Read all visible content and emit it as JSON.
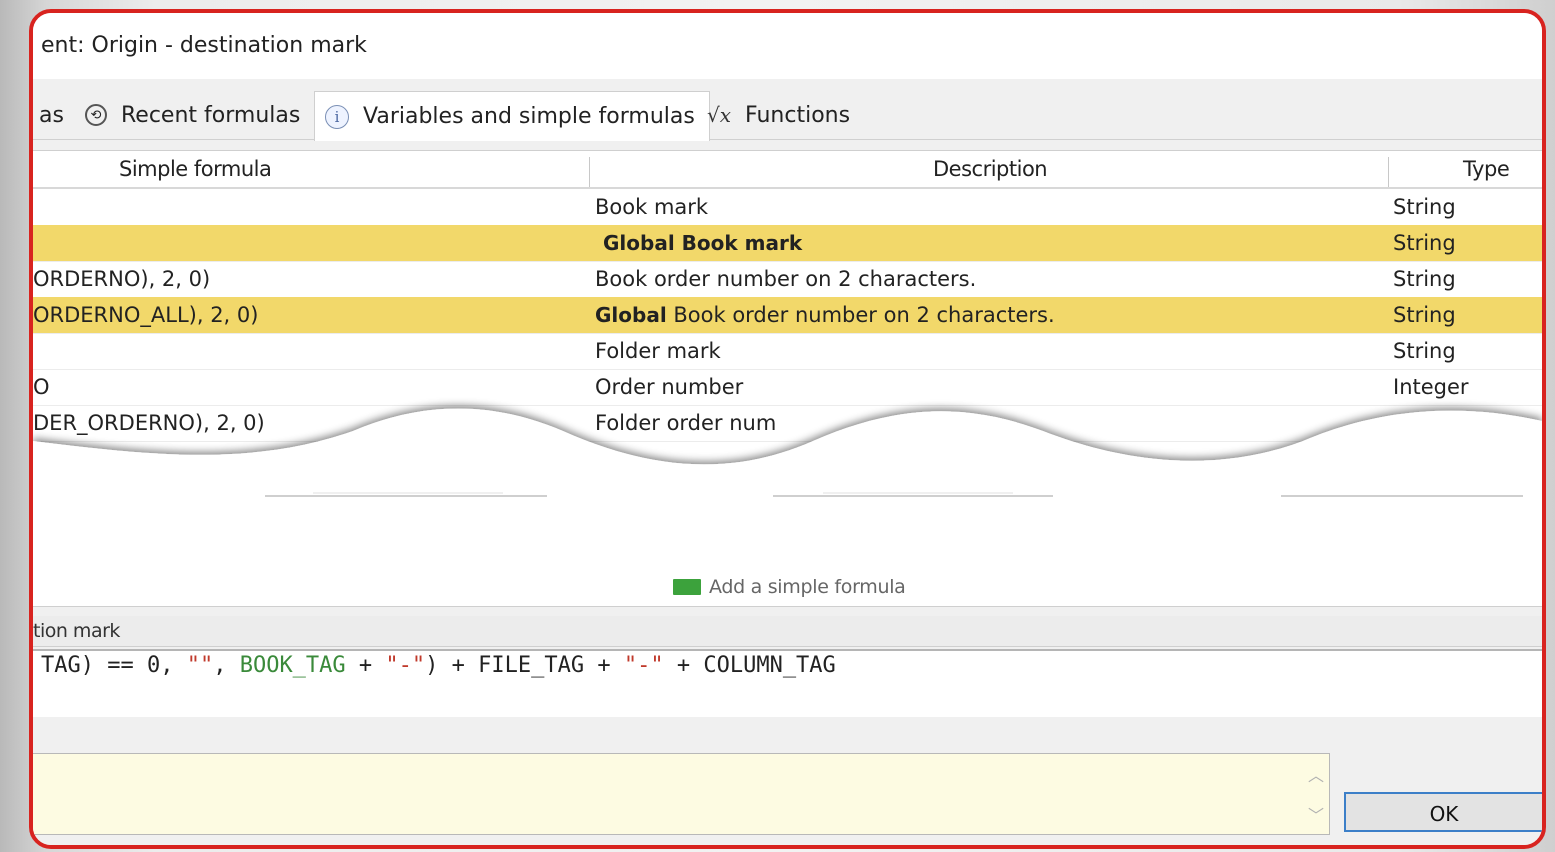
{
  "window": {
    "title": "ent: Origin - destination mark"
  },
  "tabs": [
    {
      "label": "as",
      "icon": "formulas-icon",
      "active": false
    },
    {
      "label": "Recent formulas",
      "icon": "clock-icon",
      "active": false
    },
    {
      "label": "Variables and simple formulas",
      "icon": "info-icon",
      "active": true
    },
    {
      "label": "Functions",
      "icon": "function-icon",
      "active": false
    }
  ],
  "table": {
    "headers": [
      "Simple formula",
      "Description",
      "Type"
    ],
    "rows": [
      {
        "formula": "",
        "description": "Book mark",
        "desc_bold": "",
        "type": "String",
        "highlight": false
      },
      {
        "formula": "",
        "description": "",
        "desc_bold": "Global Book mark",
        "type": "String",
        "highlight": true
      },
      {
        "formula": "ORDERNO), 2, 0)",
        "description": "Book order number on 2 characters.",
        "desc_bold": "",
        "type": "String",
        "highlight": false
      },
      {
        "formula": "ORDERNO_ALL), 2, 0)",
        "description": "Book order number on 2 characters.",
        "desc_bold": "Global",
        "type": "String",
        "highlight": true
      },
      {
        "formula": "",
        "description": "Folder mark",
        "desc_bold": "",
        "type": "String",
        "highlight": false
      },
      {
        "formula": "O",
        "description": "Order number",
        "desc_bold": "",
        "type": "Integer",
        "highlight": false
      },
      {
        "formula": "DER_ORDERNO), 2, 0)",
        "description": "Folder order num",
        "desc_bold": "",
        "type": "",
        "highlight": false
      }
    ],
    "add_label": "Add a simple formula"
  },
  "section": {
    "label": "tion mark"
  },
  "code": {
    "seg1": "TAG) == 0, ",
    "seg2": "\"\"",
    "seg3": ", ",
    "seg4": "BOOK_TAG",
    "seg5": " + ",
    "seg6": "\"-\"",
    "seg7": ") + FILE_TAG + ",
    "seg8": "\"-\"",
    "seg9": " + COLUMN_TAG"
  },
  "buttons": {
    "ok": "OK"
  },
  "colors": {
    "highlight": "#f2d86a",
    "frame": "#d8231f",
    "message_bg": "#fdfbe2"
  }
}
